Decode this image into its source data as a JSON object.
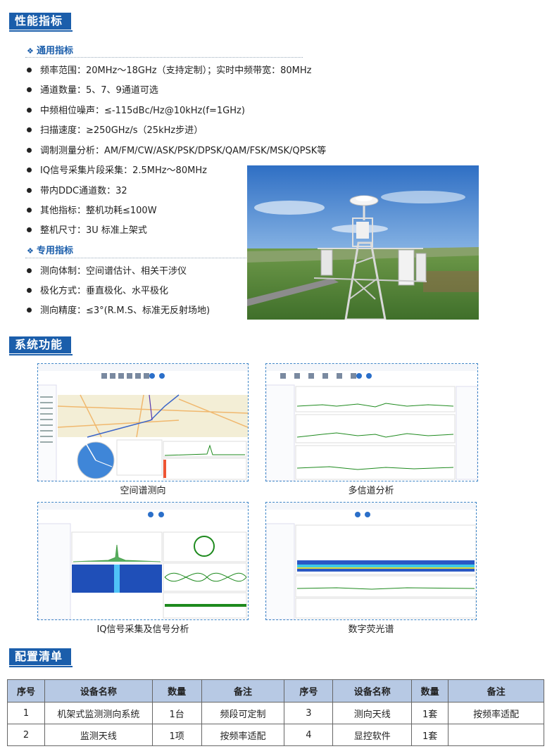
{
  "sections": {
    "performance": "性能指标",
    "functions": "系统功能",
    "config": "配置清单"
  },
  "general": {
    "title": "通用指标",
    "items": [
      "频率范围：20MHz～18GHz（支持定制）；实时中频带宽：80MHz",
      "通道数量：5、7、9通道可选",
      "中频相位噪声：≤-115dBc/Hz@10kHz(f=1GHz)",
      "扫描速度：≥250GHz/s（25kHz步进）",
      "调制测量分析：AM/FM/CW/ASK/PSK/DPSK/QAM/FSK/MSK/QPSK等",
      "IQ信号采集片段采集：2.5MHz～80MHz",
      "带内DDC通道数：32",
      "其他指标：整机功耗≤100W",
      "整机尺寸：3U 标准上架式"
    ]
  },
  "special": {
    "title": "专用指标",
    "items": [
      "测向体制：空间谱估计、相关干涉仪",
      "极化方式：垂直极化、水平极化",
      "测向精度：≤3°(R.M.S、标准无反射场地)"
    ]
  },
  "functions": [
    "空间谱测向",
    "多信道分析",
    "IQ信号采集及信号分析",
    "数字荧光谱"
  ],
  "table": {
    "headers": [
      "序号",
      "设备名称",
      "数量",
      "备注",
      "序号",
      "设备名称",
      "数量",
      "备注"
    ],
    "rows": [
      [
        "1",
        "机架式监测测向系统",
        "1台",
        "频段可定制",
        "3",
        "测向天线",
        "1套",
        "按频率适配"
      ],
      [
        "2",
        "监测天线",
        "1项",
        "按频率适配",
        "4",
        "显控软件",
        "1套",
        ""
      ]
    ]
  },
  "colors": {
    "accent": "#1b5eab",
    "table_header": "#b7c9e4"
  }
}
